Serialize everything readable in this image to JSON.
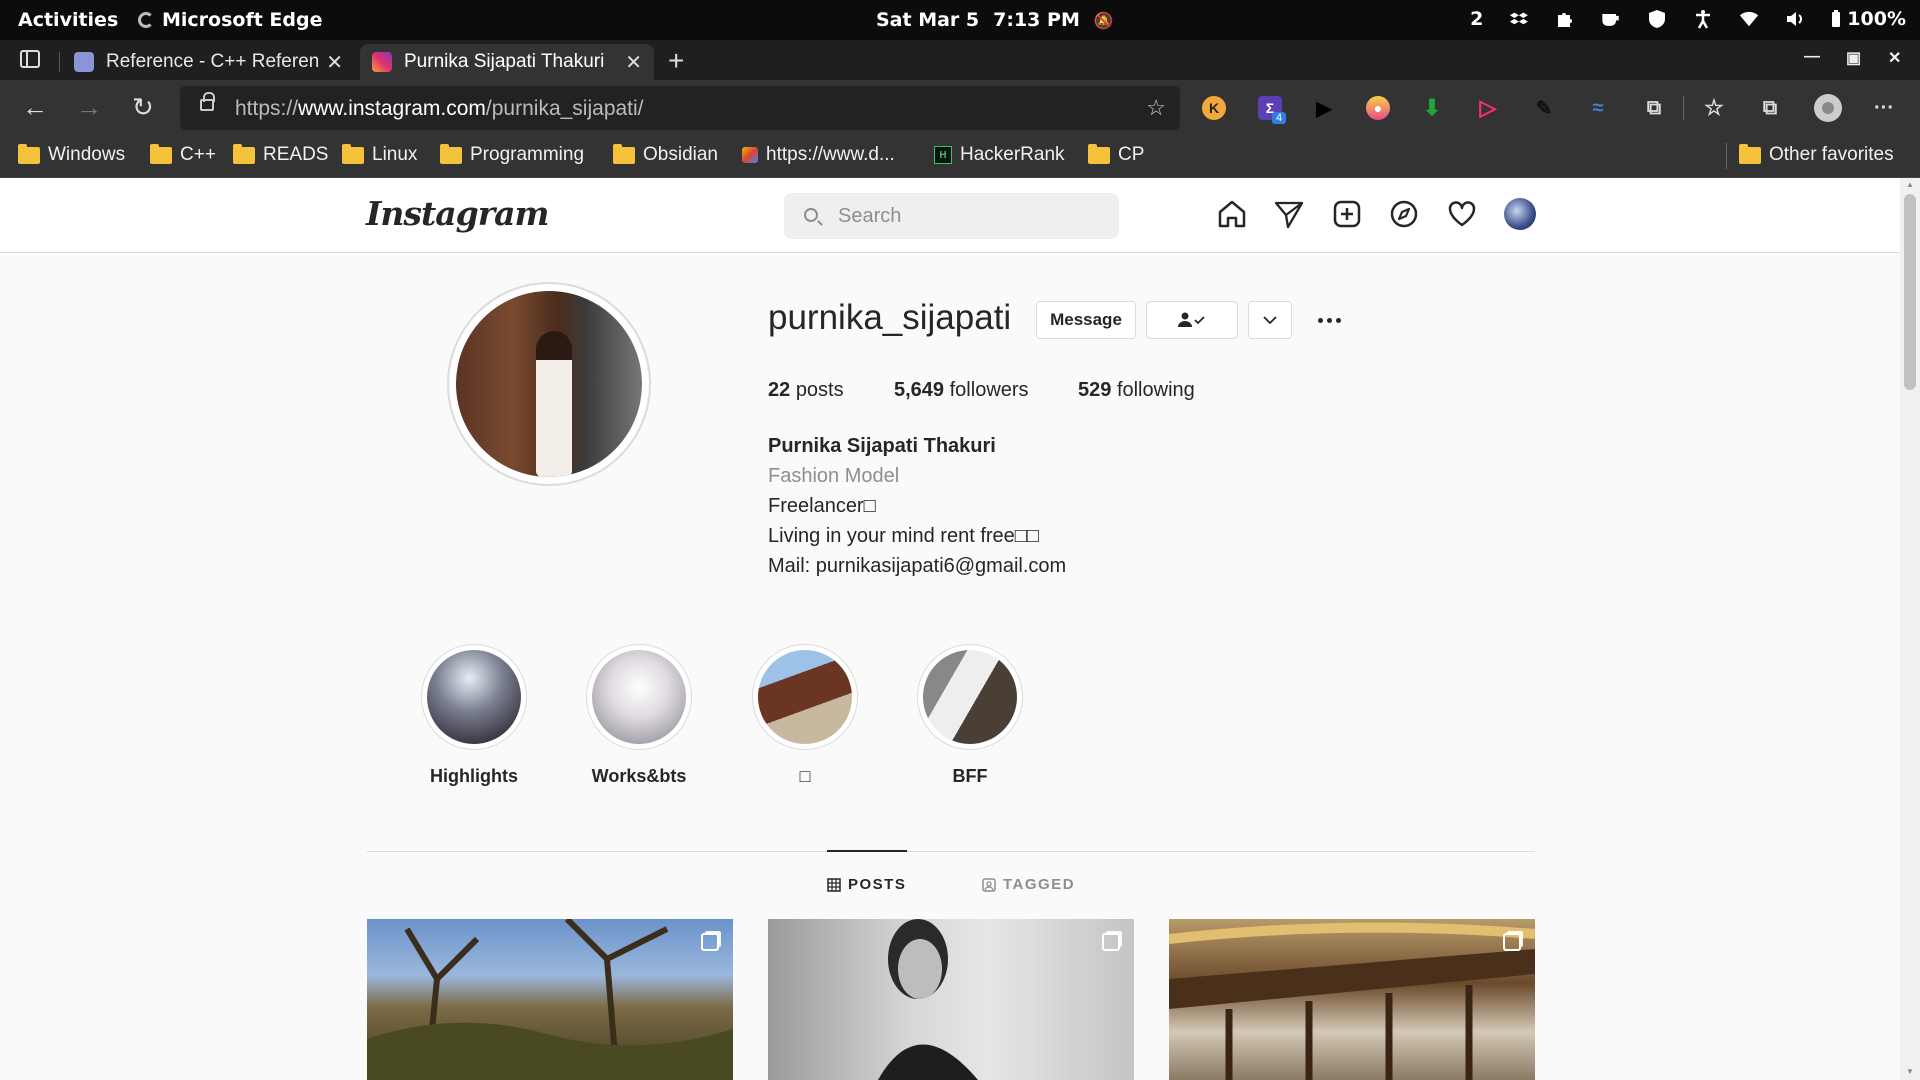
{
  "system_bar": {
    "activities": "Activities",
    "app_name": "Microsoft Edge",
    "date": "Sat Mar 5",
    "time": "7:13 PM",
    "workspace": "2",
    "battery": "100%"
  },
  "browser": {
    "tabs": [
      {
        "title": "Reference - C++ Reference",
        "active": false
      },
      {
        "title": "Purnika Sijapati Thakuri",
        "active": true
      }
    ],
    "url_scheme": "https://",
    "url_host": "www.instagram.com",
    "url_path": "/purnika_sijapati/",
    "bookmarks": [
      {
        "label": "Windows",
        "type": "folder"
      },
      {
        "label": "C++",
        "type": "folder"
      },
      {
        "label": "READS",
        "type": "folder"
      },
      {
        "label": "Linux",
        "type": "folder"
      },
      {
        "label": "Programming",
        "type": "folder"
      },
      {
        "label": "Obsidian",
        "type": "folder"
      },
      {
        "label": "https://www.d...",
        "type": "link"
      },
      {
        "label": "HackerRank",
        "type": "link"
      },
      {
        "label": "CP",
        "type": "folder"
      }
    ],
    "other_favorites": "Other favorites",
    "extension_badge": "4"
  },
  "instagram": {
    "logo": "Instagram",
    "search_placeholder": "Search",
    "profile": {
      "username": "purnika_sijapati",
      "message_label": "Message",
      "posts_count": "22",
      "posts_label": "posts",
      "followers_count": "5,649",
      "followers_label": "followers",
      "following_count": "529",
      "following_label": "following",
      "full_name": "Purnika Sijapati Thakuri",
      "category": "Fashion Model",
      "bio_lines": [
        "Freelancer□",
        "Living in your mind rent free□□",
        "Mail: purnikasijapati6@gmail.com"
      ]
    },
    "highlights": [
      {
        "label": "Highlights"
      },
      {
        "label": "Works&bts"
      },
      {
        "label": "□"
      },
      {
        "label": "BFF"
      }
    ],
    "tabs": {
      "posts": "POSTS",
      "tagged": "TAGGED"
    }
  }
}
